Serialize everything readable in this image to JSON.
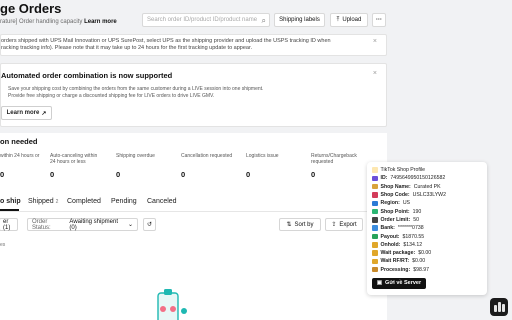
{
  "header": {
    "title": "ge Orders",
    "subtitle": "rature] Order handling capacity",
    "subtitle_link": "Learn more",
    "search_placeholder": "Search order ID/product ID/product name",
    "shipping_labels": "Shipping labels",
    "upload": "Upload",
    "more": "···"
  },
  "banner": {
    "line1": "orders shipped with UPS Mail Innovation or UPS SurePost, select UPS as the shipping provider and upload the USPS tracking ID when",
    "line2": "racking tracking info). Please note that it may take up to 24 hours for the first tracking update to appear."
  },
  "combine_card": {
    "title": "Automated order combination is now supported",
    "line1": "Save your shipping cost by combining the orders from the same customer during a LIVE session into one shipment.",
    "line2": "Provide free shipping or charge a discounted shipping fee for LIVE orders to drive LIVE GMV.",
    "button": "Learn more"
  },
  "attention": {
    "title": "on needed",
    "metrics": [
      {
        "label": "within 24 hours or",
        "label2": "",
        "value": "0"
      },
      {
        "label": "Auto-canceling within",
        "label2": "24 hours or less",
        "value": "0"
      },
      {
        "label": "Shipping overdue",
        "label2": "",
        "value": "0"
      },
      {
        "label": "Cancellation requested",
        "label2": "",
        "value": "0"
      },
      {
        "label": "Logistics issue",
        "label2": "",
        "value": "0"
      },
      {
        "label": "Returns/Chargeback",
        "label2": "requested",
        "value": "0"
      }
    ]
  },
  "tabs": {
    "items": [
      {
        "label": "o ship",
        "count": ""
      },
      {
        "label": "Shipped",
        "count": "2"
      },
      {
        "label": "Completed",
        "count": ""
      },
      {
        "label": "Pending",
        "count": ""
      },
      {
        "label": "Canceled",
        "count": ""
      }
    ]
  },
  "filters": {
    "filter_label": "er (1)",
    "order_status_label": "Order Status:",
    "order_status_value": "Awaiting shipment (0)",
    "sort_by": "Sort by",
    "export": "Export",
    "results_label": "es"
  },
  "profile_panel": {
    "title": "TikTok Shop Profile",
    "rows": [
      {
        "icon": "id-icon",
        "color": "#6b4fd8",
        "key": "ID:",
        "value": "7495649950150126582"
      },
      {
        "icon": "shop-icon",
        "color": "#d9a43a",
        "key": "Shop Name:",
        "value": "Curated PK"
      },
      {
        "icon": "code-icon",
        "color": "#d33b5a",
        "key": "Shop Code:",
        "value": "USLC33LYW2"
      },
      {
        "icon": "region-icon",
        "color": "#2b7bd6",
        "key": "Region:",
        "value": "US"
      },
      {
        "icon": "point-icon",
        "color": "#2bb673",
        "key": "Shop Point:",
        "value": "190"
      },
      {
        "icon": "limit-icon",
        "color": "#444444",
        "key": "Order Limit:",
        "value": "50"
      },
      {
        "icon": "bank-icon",
        "color": "#3c8dde",
        "key": "Bank:",
        "value": "*******0738"
      },
      {
        "icon": "payout-icon",
        "color": "#27a35a",
        "key": "Payout:",
        "value": "$1870.55"
      },
      {
        "icon": "onhold-icon",
        "color": "#e0a72a",
        "key": "Onhold:",
        "value": "$134.12"
      },
      {
        "icon": "package-icon",
        "color": "#e0a72a",
        "key": "Wait package:",
        "value": "$0.00"
      },
      {
        "icon": "rfrt-icon",
        "color": "#e0a72a",
        "key": "Wait RF/RT:",
        "value": "$0.00"
      },
      {
        "icon": "processing-icon",
        "color": "#c98a2a",
        "key": "Processing:",
        "value": "$98.97"
      }
    ],
    "button": "Gửi về Server"
  }
}
